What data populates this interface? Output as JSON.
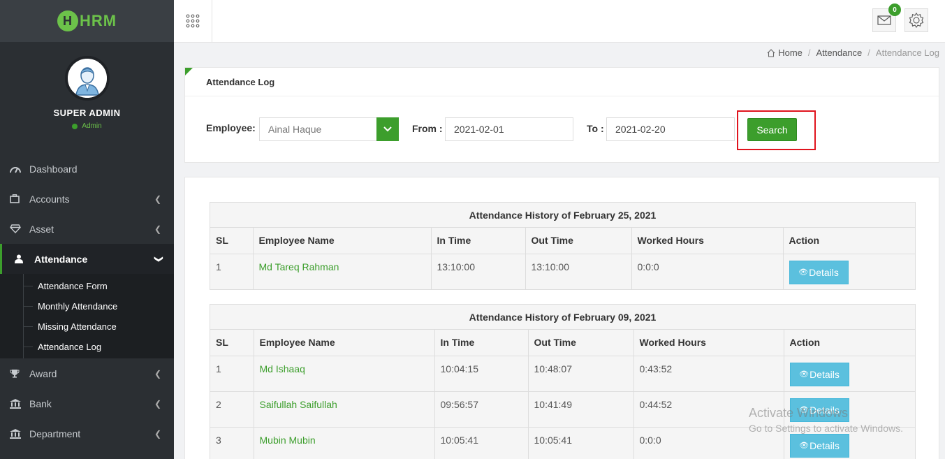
{
  "app": {
    "logo_text": "HRM",
    "logo_letter": "H"
  },
  "profile": {
    "name": "SUPER ADMIN",
    "role": "Admin"
  },
  "nav": {
    "dashboard": "Dashboard",
    "accounts": "Accounts",
    "asset": "Asset",
    "attendance": "Attendance",
    "award": "Award",
    "bank": "Bank",
    "department": "Department",
    "attendance_sub": [
      "Attendance Form",
      "Monthly Attendance",
      "Missing Attendance",
      "Attendance Log"
    ]
  },
  "topbar": {
    "mail_count": "0"
  },
  "breadcrumb": {
    "home": "Home",
    "section": "Attendance",
    "current": "Attendance Log"
  },
  "filter": {
    "title": "Attendance Log",
    "employee_label": "Employee:",
    "employee_value": "Ainal Haque",
    "from_label": "From :",
    "from_value": "2021-02-01",
    "to_label": "To :",
    "to_value": "2021-02-20",
    "search_label": "Search"
  },
  "columns": [
    "SL",
    "Employee Name",
    "In Time",
    "Out Time",
    "Worked Hours",
    "Action"
  ],
  "details_label": "Details",
  "history": [
    {
      "title": "Attendance History of February 25, 2021",
      "rows": [
        {
          "sl": "1",
          "name": "Md Tareq Rahman",
          "in": "13:10:00",
          "out": "13:10:00",
          "hours": "0:0:0"
        }
      ]
    },
    {
      "title": "Attendance History of February 09, 2021",
      "rows": [
        {
          "sl": "1",
          "name": "Md Ishaaq",
          "in": "10:04:15",
          "out": "10:48:07",
          "hours": "0:43:52"
        },
        {
          "sl": "2",
          "name": "Saifullah Saifullah",
          "in": "09:56:57",
          "out": "10:41:49",
          "hours": "0:44:52"
        },
        {
          "sl": "3",
          "name": "Mubin Mubin",
          "in": "10:05:41",
          "out": "10:05:41",
          "hours": "0:0:0"
        }
      ]
    }
  ],
  "watermark": {
    "line1": "Activate Windows",
    "line2": "Go to Settings to activate Windows."
  },
  "colors": {
    "brand": "#3c9e2c",
    "sidebar": "#2b2f33",
    "details": "#5bc0de",
    "highlight": "#e0141e"
  }
}
